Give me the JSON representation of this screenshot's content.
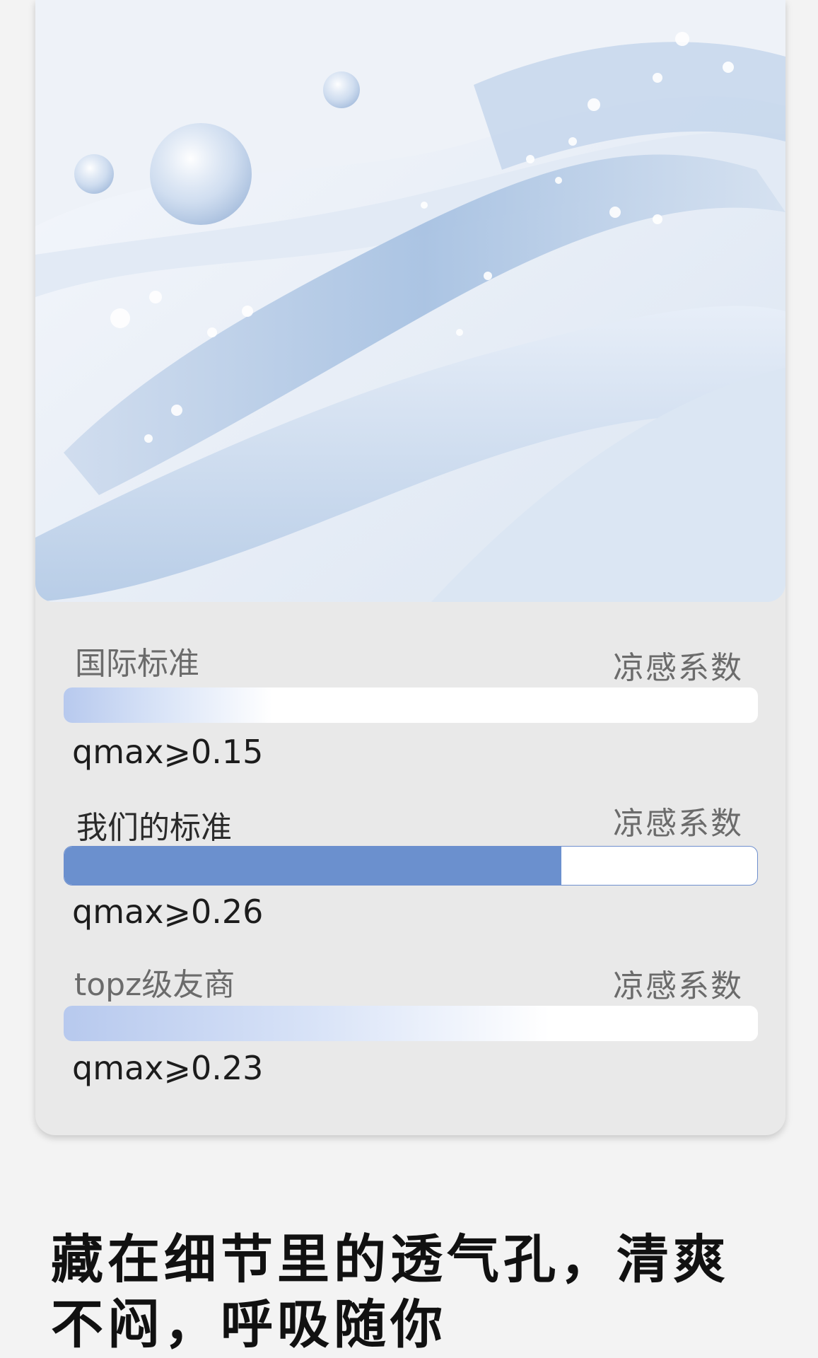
{
  "rows": [
    {
      "label": "国际标准",
      "right_label": "凉感系数",
      "value_text": "qmax⩾0.15",
      "fill": 0.3
    },
    {
      "label": "我们的标准",
      "right_label": "凉感系数",
      "value_text": "qmax⩾0.26",
      "fill": 0.717
    },
    {
      "label": "topz级友商",
      "right_label": "凉感系数",
      "value_text": "qmax⩾0.23",
      "fill": 1.0
    }
  ],
  "headline": "藏在细节里的透气孔，清爽不闷，呼吸随你",
  "colors": {
    "accent_bar": "#6b90ce",
    "gradient_start": "#b7c9ee",
    "card_bg": "#e9e9e9",
    "page_bg": "#f3f3f3"
  }
}
